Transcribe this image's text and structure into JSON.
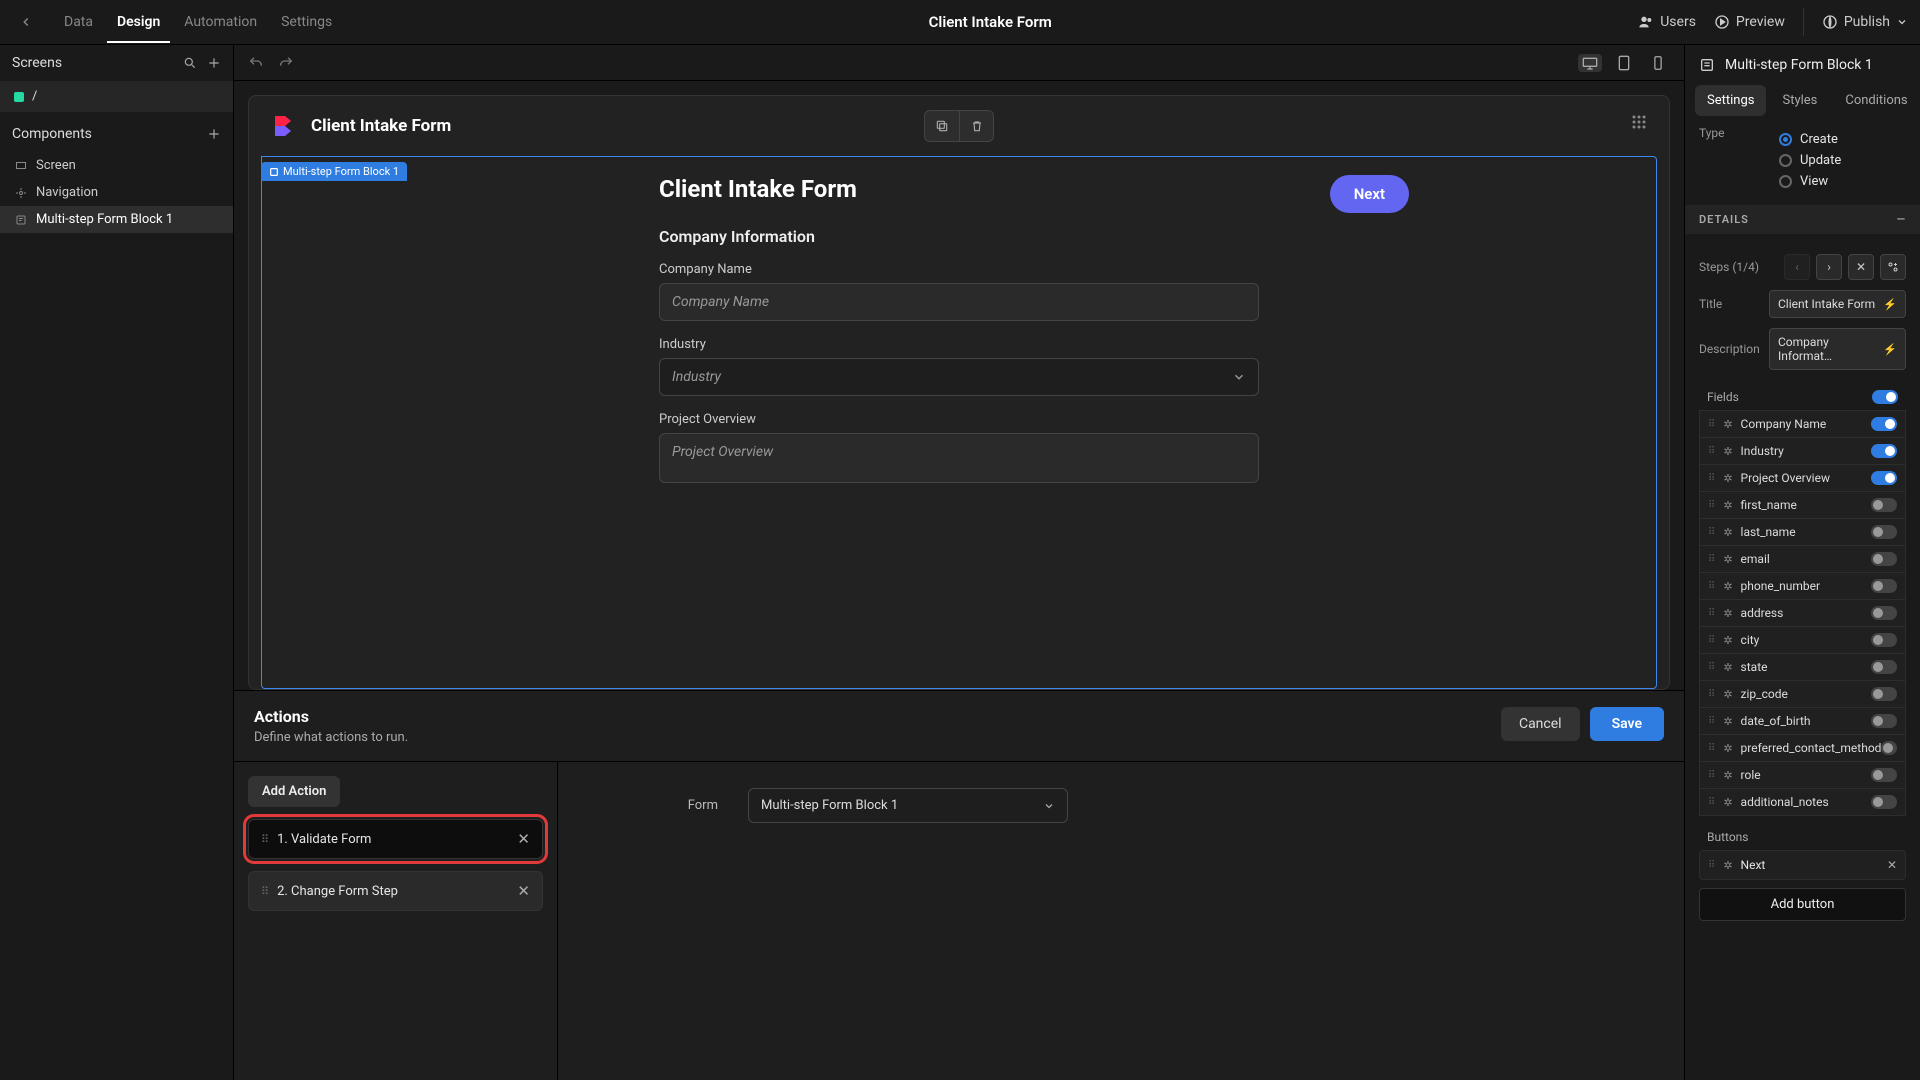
{
  "topnav": {
    "tabs": [
      "Data",
      "Design",
      "Automation",
      "Settings"
    ],
    "active": "Design",
    "app_title": "Client Intake Form",
    "right": {
      "users": "Users",
      "preview": "Preview",
      "publish": "Publish"
    }
  },
  "left": {
    "screens_label": "Screens",
    "screen_name": "/",
    "components_label": "Components",
    "components": [
      {
        "label": "Screen",
        "icon": "screen"
      },
      {
        "label": "Navigation",
        "icon": "nav"
      },
      {
        "label": "Multi-step Form Block 1",
        "icon": "form",
        "active": true
      }
    ]
  },
  "canvas": {
    "card_title": "Client Intake Form",
    "block_tag": "Multi-step Form Block 1",
    "form_title": "Client Intake Form",
    "next_label": "Next",
    "section_title": "Company Information",
    "fields": [
      {
        "label": "Company Name",
        "placeholder": "Company Name",
        "type": "text"
      },
      {
        "label": "Industry",
        "placeholder": "Industry",
        "type": "select"
      },
      {
        "label": "Project Overview",
        "placeholder": "Project Overview",
        "type": "textarea"
      }
    ]
  },
  "actions": {
    "title": "Actions",
    "subtitle": "Define what actions to run.",
    "cancel": "Cancel",
    "save": "Save",
    "add_action": "Add Action",
    "items": [
      {
        "label": "1. Validate Form",
        "selected": true,
        "highlighted": true
      },
      {
        "label": "2. Change Form Step",
        "selected": false
      }
    ],
    "form_label": "Form",
    "form_value": "Multi-step Form Block 1"
  },
  "right": {
    "block_name": "Multi-step Form Block 1",
    "tabs": [
      "Settings",
      "Styles",
      "Conditions"
    ],
    "active_tab": "Settings",
    "type_label": "Type",
    "type_options": [
      {
        "label": "Create",
        "on": true
      },
      {
        "label": "Update",
        "on": false
      },
      {
        "label": "View",
        "on": false
      }
    ],
    "details_label": "DETAILS",
    "steps_label": "Steps (1/4)",
    "title_label": "Title",
    "title_value": "Client Intake Form",
    "desc_label": "Description",
    "desc_value": "Company Informat…",
    "fields_label": "Fields",
    "fields": [
      {
        "label": "Company Name",
        "on": true
      },
      {
        "label": "Industry",
        "on": true
      },
      {
        "label": "Project Overview",
        "on": true
      },
      {
        "label": "first_name",
        "on": false
      },
      {
        "label": "last_name",
        "on": false
      },
      {
        "label": "email",
        "on": false
      },
      {
        "label": "phone_number",
        "on": false
      },
      {
        "label": "address",
        "on": false
      },
      {
        "label": "city",
        "on": false
      },
      {
        "label": "state",
        "on": false
      },
      {
        "label": "zip_code",
        "on": false
      },
      {
        "label": "date_of_birth",
        "on": false
      },
      {
        "label": "preferred_contact_method",
        "on": false
      },
      {
        "label": "role",
        "on": false
      },
      {
        "label": "additional_notes",
        "on": false
      }
    ],
    "buttons_label": "Buttons",
    "button_item": "Next",
    "add_button": "Add button"
  }
}
